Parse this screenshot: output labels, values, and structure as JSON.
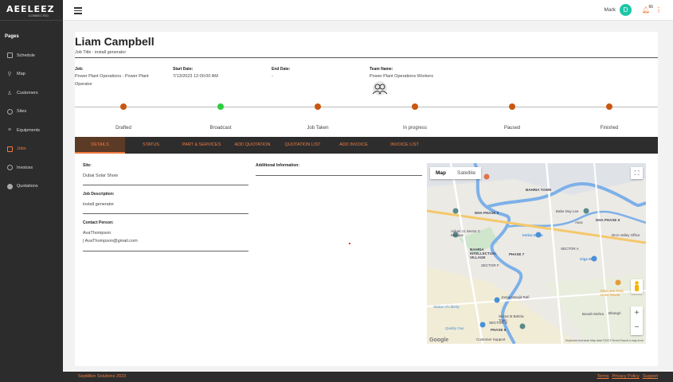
{
  "brand": {
    "logo": "AEELEEZ",
    "tagline": "CONNECTED"
  },
  "sidebar": {
    "section_label": "Pages",
    "items": [
      {
        "label": "Schedule"
      },
      {
        "label": "Map"
      },
      {
        "label": "Customers"
      },
      {
        "label": "Sites"
      },
      {
        "label": "Equipments"
      },
      {
        "label": "Jobs"
      },
      {
        "label": "Invoices"
      },
      {
        "label": "Quotations"
      }
    ],
    "active": "Jobs"
  },
  "topbar": {
    "user_name": "Mark",
    "avatar_initial": "D",
    "notification_count": "66"
  },
  "employee": {
    "name": "Liam Campbell",
    "job_title": "Job Title : install generator"
  },
  "job_info": {
    "job_label": "Job:",
    "job_value": "Power Plant Operations - Power Plant Operator",
    "start_label": "Start Date:",
    "start_value": "7/13/2023 12:00:00 AM",
    "end_label": "End Date:",
    "end_value": "-",
    "team_label": "Team Name:",
    "team_value": "Power Plant Operations Workers"
  },
  "timeline": {
    "steps": [
      {
        "label": "Drafted",
        "color": "#c8570f"
      },
      {
        "label": "Broadcast",
        "color": "#2ecc40"
      },
      {
        "label": "Job Taken",
        "color": "#c8570f"
      },
      {
        "label": "In progress",
        "color": "#c8570f"
      },
      {
        "label": "Paused",
        "color": "#c8570f"
      },
      {
        "label": "Finished",
        "color": "#c8570f"
      }
    ]
  },
  "tabs": [
    {
      "label": "DETAILS"
    },
    {
      "label": "STATUS"
    },
    {
      "label": "PART & SERVICES"
    },
    {
      "label": "ADD QUOTATION"
    },
    {
      "label": "QUOTATION LIST"
    },
    {
      "label": "ADD INVOICE"
    },
    {
      "label": "INVOICE LIST"
    }
  ],
  "details": {
    "site_label": "Site:",
    "site_value": "Dubai Solar Show",
    "desc_label": "Job Description:",
    "desc_value": "install generator",
    "contact_label": "Contact Person:",
    "contact_name": "AvaThompson",
    "contact_email": "| AvaThompson@gmail.com",
    "additional_label": "Additional Information:"
  },
  "map": {
    "map_tab": "Map",
    "satellite_tab": "Satellite",
    "places": [
      "BAHRIA TOWN",
      "DHA PHASE II",
      "DHA PHASE II",
      "Babe Day Lee",
      "Aara",
      "Imtiaz Mega",
      "DHA Valley Office",
      "Askari 11 Sector C Mosque",
      "BAHRIA INTELLECTUAL VILLAGE",
      "Gigs Mall",
      "Jamia Masjid Rafi",
      "Statue of Liberty",
      "Sector B Bahria Town",
      "Quality Gas",
      "Customer Support",
      "Bunah Mohra",
      "Bhangri",
      "Mian Jee Punj Hotel Rawat",
      "PHASE 8",
      "PHASE 7",
      "SECTOR F",
      "SECTOR A",
      "SECTOR B"
    ],
    "footer": "Keyboard shortcuts   Map data ©2023   Terms   Report a map error",
    "logo": "Google"
  },
  "footer": {
    "copyright": "Septillion Solutions 2023",
    "terms": "Terms",
    "privacy": "Privacy Policy",
    "support": "Support"
  },
  "colors": {
    "accent": "#f07b3f",
    "sidebar_bg": "#2c2c2c",
    "tab_bar_bg": "#2d2d2d",
    "avatar_bg": "#1cc6a8"
  }
}
